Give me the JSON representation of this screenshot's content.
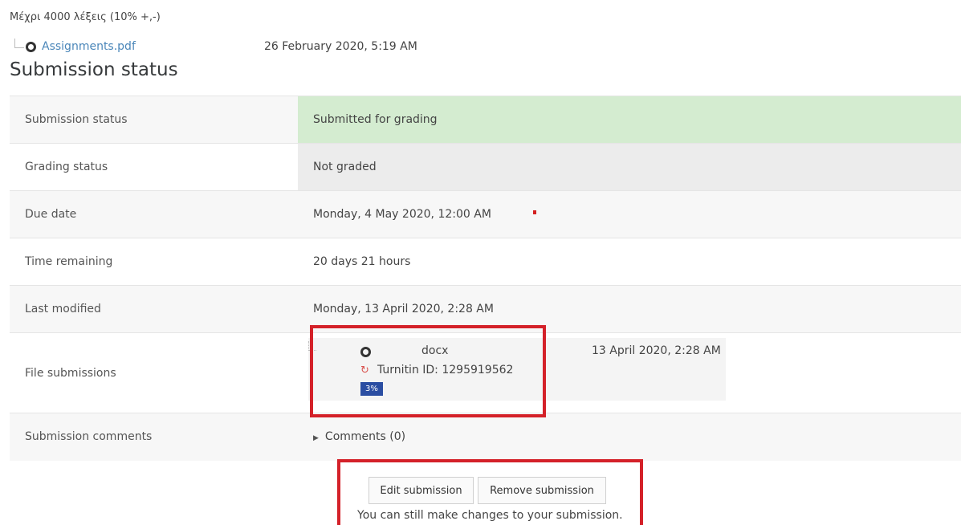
{
  "intro": {
    "text": "Μέχρι 4000 λέξεις (10% +,-)"
  },
  "attachment": {
    "filename": "Assignments.pdf",
    "date": "26 February 2020, 5:19 AM",
    "icon": "pdf-file-icon"
  },
  "section": {
    "title": "Submission status"
  },
  "rows": {
    "submission_status": {
      "label": "Submission status",
      "value": "Submitted for grading"
    },
    "grading_status": {
      "label": "Grading status",
      "value": "Not graded"
    },
    "due_date": {
      "label": "Due date",
      "value": "Monday, 4 May 2020, 12:00 AM"
    },
    "time_remaining": {
      "label": "Time remaining",
      "value": "20 days 21 hours"
    },
    "last_modified": {
      "label": "Last modified",
      "value": "Monday, 13 April 2020, 2:28 AM"
    },
    "file_submissions": {
      "label": "File submissions",
      "file_name": "docx",
      "file_date": "13 April 2020, 2:28 AM",
      "turnitin_id": "Turnitin ID: 1295919562",
      "similarity": "3%"
    },
    "comments": {
      "label": "Submission comments",
      "value": "Comments (0)"
    }
  },
  "actions": {
    "edit_label": "Edit submission",
    "remove_label": "Remove submission",
    "note": "You can still make changes to your submission."
  },
  "colors": {
    "submitted_bg": "#d4ecd0",
    "highlight_border": "#d42129",
    "similarity_badge": "#2b4ea2",
    "link": "#4a86b9"
  }
}
